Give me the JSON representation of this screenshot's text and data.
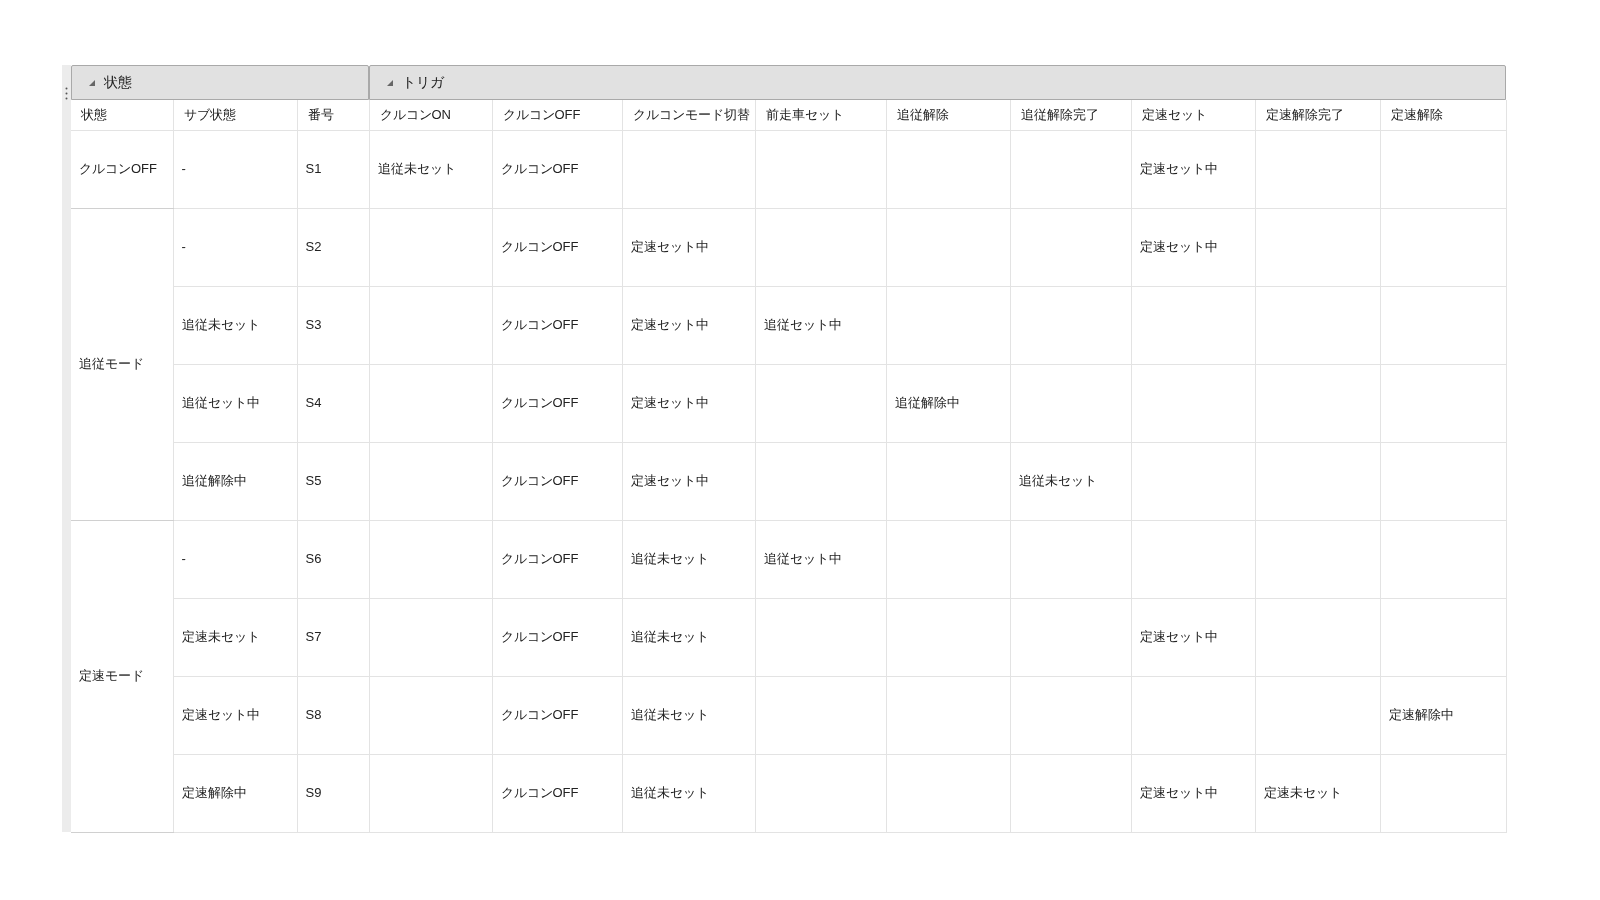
{
  "column_groups": [
    {
      "label": "状態",
      "expanded": true
    },
    {
      "label": "トリガ",
      "expanded": true
    }
  ],
  "columns": [
    "状態",
    "サブ状態",
    "番号",
    "クルコンON",
    "クルコンOFF",
    "クルコンモード切替",
    "前走車セット",
    "追従解除",
    "追従解除完了",
    "定速セット",
    "定速解除完了",
    "定速解除"
  ],
  "groups": [
    {
      "state": "クルコンOFF",
      "rows": [
        {
          "substate": "-",
          "number": "S1",
          "cruise_on": "追従未セット",
          "cruise_off": "クルコンOFF",
          "speed_set": "定速セット中"
        }
      ]
    },
    {
      "state": "追従モード",
      "rows": [
        {
          "substate": "-",
          "number": "S2",
          "cruise_off": "クルコンOFF",
          "mode_switch": "定速セット中",
          "speed_set": "定速セット中"
        },
        {
          "substate": "追従未セット",
          "number": "S3",
          "cruise_off": "クルコンOFF",
          "mode_switch": "定速セット中",
          "lead_car_set": "追従セット中"
        },
        {
          "substate": "追従セット中",
          "number": "S4",
          "cruise_off": "クルコンOFF",
          "mode_switch": "定速セット中",
          "follow_release": "追従解除中"
        },
        {
          "substate": "追従解除中",
          "number": "S5",
          "cruise_off": "クルコンOFF",
          "mode_switch": "定速セット中",
          "follow_release_done": "追従未セット"
        }
      ]
    },
    {
      "state": "定速モード",
      "rows": [
        {
          "substate": "-",
          "number": "S6",
          "cruise_off": "クルコンOFF",
          "mode_switch": "追従未セット",
          "lead_car_set": "追従セット中"
        },
        {
          "substate": "定速未セット",
          "number": "S7",
          "cruise_off": "クルコンOFF",
          "mode_switch": "追従未セット",
          "speed_set": "定速セット中"
        },
        {
          "substate": "定速セット中",
          "number": "S8",
          "cruise_off": "クルコンOFF",
          "mode_switch": "追従未セット",
          "speed_release": "定速解除中"
        },
        {
          "substate": "定速解除中",
          "number": "S9",
          "cruise_off": "クルコンOFF",
          "mode_switch": "追従未セット",
          "speed_set": "定速セット中",
          "speed_release_done": "定速未セット"
        }
      ]
    }
  ]
}
